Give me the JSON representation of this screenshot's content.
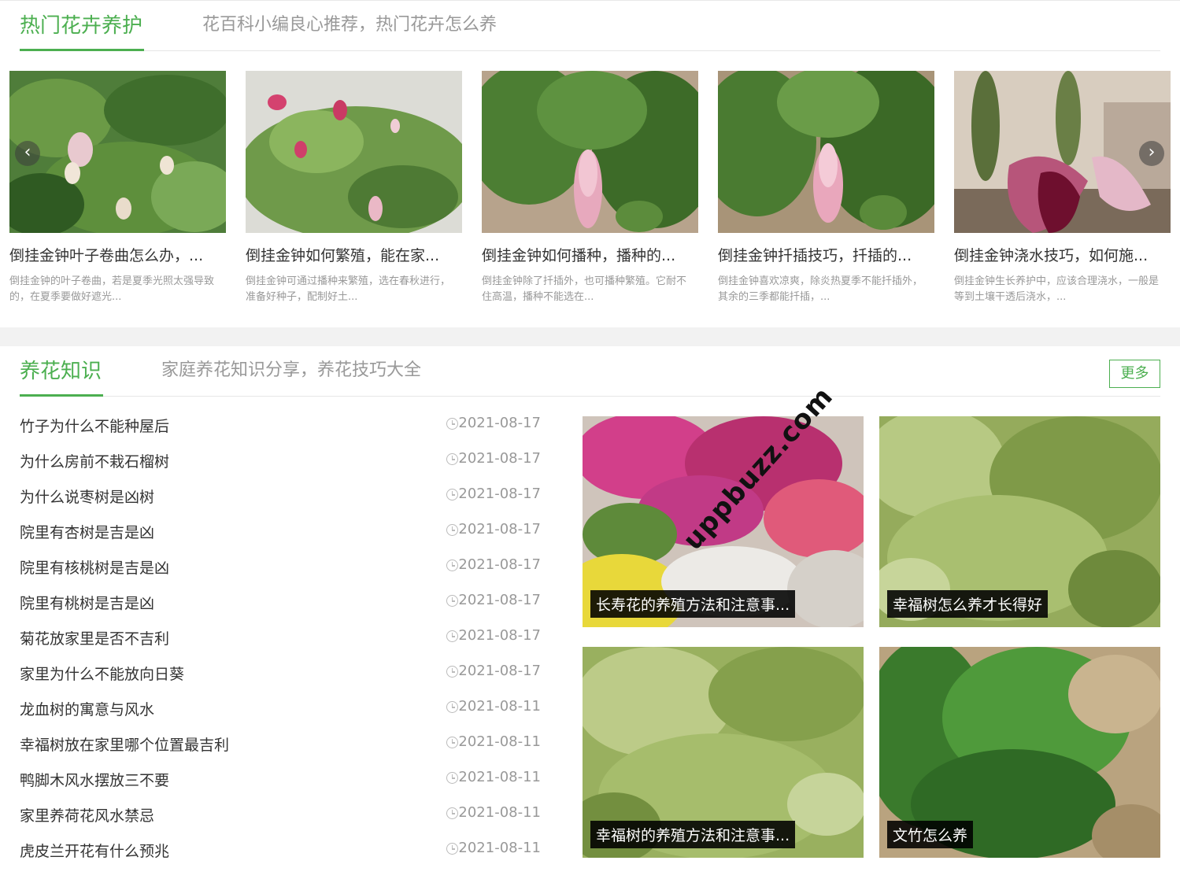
{
  "hot": {
    "title": "热门花卉养护",
    "subtitle": "花百科小编良心推荐，热门花卉怎么养",
    "cards": [
      {
        "title": "倒挂金钟叶子卷曲怎么办，...",
        "desc": "倒挂金钟的叶子卷曲，若是夏季光照太强导致的，在夏季要做好遮光..."
      },
      {
        "title": "倒挂金钟如何繁殖，能在家...",
        "desc": "倒挂金钟可通过播种来繁殖，选在春秋进行，准备好种子，配制好土..."
      },
      {
        "title": "倒挂金钟如何播种，播种的...",
        "desc": "倒挂金钟除了扦插外，也可播种繁殖。它耐不住高温，播种不能选在..."
      },
      {
        "title": "倒挂金钟扦插技巧，扦插的...",
        "desc": "倒挂金钟喜欢凉爽，除炎热夏季不能扦插外，其余的三季都能扦插，..."
      },
      {
        "title": "倒挂金钟浇水技巧，如何施...",
        "desc": "倒挂金钟生长养护中，应该合理浇水，一般是等到土壤干透后浇水，..."
      }
    ],
    "prev_glyph": "‹",
    "next_glyph": "›"
  },
  "knowledge": {
    "title": "养花知识",
    "subtitle": "家庭养花知识分享，养花技巧大全",
    "more_label": "更多",
    "items": [
      {
        "title": "竹子为什么不能种屋后",
        "date": "2021-08-17"
      },
      {
        "title": "为什么房前不栽石榴树",
        "date": "2021-08-17"
      },
      {
        "title": "为什么说枣树是凶树",
        "date": "2021-08-17"
      },
      {
        "title": "院里有杏树是吉是凶",
        "date": "2021-08-17"
      },
      {
        "title": "院里有核桃树是吉是凶",
        "date": "2021-08-17"
      },
      {
        "title": "院里有桃树是吉是凶",
        "date": "2021-08-17"
      },
      {
        "title": "菊花放家里是否不吉利",
        "date": "2021-08-17"
      },
      {
        "title": "家里为什么不能放向日葵",
        "date": "2021-08-17"
      },
      {
        "title": "龙血树的寓意与风水",
        "date": "2021-08-11"
      },
      {
        "title": "幸福树放在家里哪个位置最吉利",
        "date": "2021-08-11"
      },
      {
        "title": "鸭脚木风水摆放三不要",
        "date": "2021-08-11"
      },
      {
        "title": "家里养荷花风水禁忌",
        "date": "2021-08-11"
      },
      {
        "title": "虎皮兰开花有什么预兆",
        "date": "2021-08-11"
      }
    ],
    "tiles": [
      {
        "caption": "长寿花的养殖方法和注意事..."
      },
      {
        "caption": "幸福树怎么养才长得好"
      },
      {
        "caption": "幸福树的养殖方法和注意事..."
      },
      {
        "caption": "文竹怎么养"
      }
    ]
  },
  "watermark": "uppbuzz.com",
  "colors": {
    "accent": "#4caf50",
    "muted": "#999999",
    "divider": "#f2f2f2"
  }
}
